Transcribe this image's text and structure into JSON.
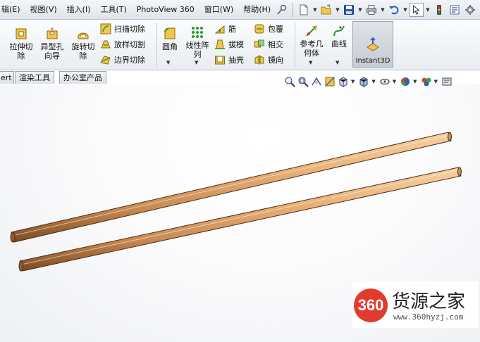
{
  "menubar": {
    "items": [
      "辑(E)",
      "视图(V)",
      "插入(I)",
      "工具(T)",
      "PhotoView 360",
      "窗口(W)",
      "帮助(H)"
    ]
  },
  "ribbon": {
    "extrude_cut": "拉伸切\n除",
    "hole_wizard": "异型孔\n向导",
    "revolve_cut": "旋转切\n除",
    "swept_cut": "扫描切除",
    "lofted_cut": "放样切割",
    "boundary_cut": "边界切除",
    "fillet": "圆角",
    "linear_pattern": "线性阵\n列",
    "rib": "筋",
    "draft": "拔模",
    "shell": "抽壳",
    "wrap": "包覆",
    "intersect": "相交",
    "mirror": "镜向",
    "ref_geometry": "参考几\n何体",
    "curves": "曲线",
    "instant3d": "Instant3D"
  },
  "tabs": [
    "ert",
    "渲染工具",
    "办公室产品"
  ],
  "watermark": {
    "badge": "360",
    "title": "货源之家",
    "url": "www.360hyzj.com"
  },
  "colors": {
    "wood_light": "#e8b27a",
    "wood_dark": "#7a4a22",
    "accent_red": "#e23b2e"
  }
}
